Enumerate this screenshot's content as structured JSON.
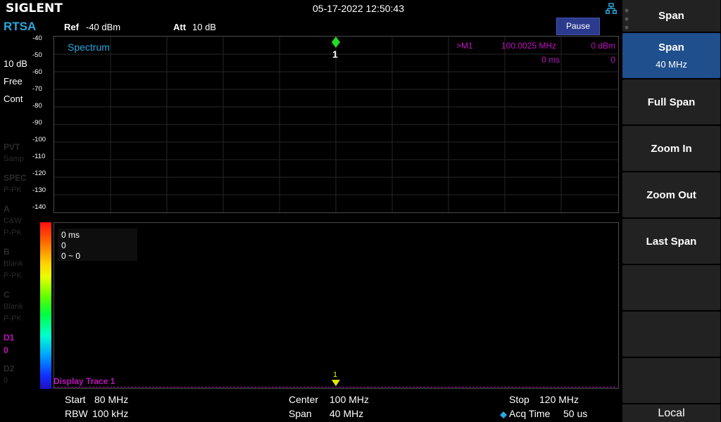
{
  "header": {
    "brand": "SIGLENT",
    "datetime": "05-17-2022 12:50:43",
    "mode": "RTSA",
    "ref_label": "Ref",
    "ref_value": "-40 dBm",
    "att_label": "Att",
    "att_value": "10 dB",
    "pause_label": "Pause",
    "network_icon": "lan-icon"
  },
  "left_panel": {
    "scale": "10 dB",
    "trigger": "Free",
    "sweep": "Cont",
    "pvt": "PVT",
    "pvt_sub": "Samp",
    "spec": "SPEC",
    "spec_sub": "P-PK",
    "a": "A",
    "a_sub1": "C&W",
    "a_sub2": "P-PK",
    "b": "B",
    "b_sub1": "Blank",
    "b_sub2": "P-PK",
    "c": "C",
    "c_sub1": "Blank",
    "c_sub2": "P-PK",
    "d1": "D1",
    "d1_sub": "0",
    "d2": "D2",
    "d2_sub": "0"
  },
  "spectrum": {
    "title": "Spectrum",
    "y_ticks": [
      "-40",
      "-50",
      "-60",
      "-70",
      "-80",
      "-90",
      "-100",
      "-110",
      "-120",
      "-130",
      "-140"
    ],
    "marker_number": "1",
    "marker_row1": {
      "label": ">M1",
      "freq": "100.0025 MHz",
      "level": "0 dBm"
    },
    "marker_row2": {
      "time": "0 ms",
      "value": "0"
    }
  },
  "waterfall": {
    "info_line1": "0 ms",
    "info_line2": "0",
    "info_line3": "0 ~ 0",
    "marker_number": "1",
    "display_trace": "Display Trace 1"
  },
  "bottom": {
    "start_label": "Start",
    "start_value": "80 MHz",
    "center_label": "Center",
    "center_value": "100 MHz",
    "stop_label": "Stop",
    "stop_value": "120 MHz",
    "rbw_label": "RBW",
    "rbw_value": "100 kHz",
    "span_label": "Span",
    "span_value": "40 MHz",
    "acq_label": "Acq Time",
    "acq_value": "50 us"
  },
  "menu": {
    "title": "Span",
    "items": [
      {
        "label": "Span",
        "value": "40 MHz"
      },
      {
        "label": "Full Span"
      },
      {
        "label": "Zoom In"
      },
      {
        "label": "Zoom Out"
      },
      {
        "label": "Last Span"
      }
    ],
    "local": "Local"
  },
  "colors": {
    "accent_blue": "#2aa7e0",
    "marker_magenta": "#c010c0",
    "marker_green": "#22dd22",
    "marker_yellow": "#e6e600",
    "active_menu": "#1f4f8c"
  }
}
